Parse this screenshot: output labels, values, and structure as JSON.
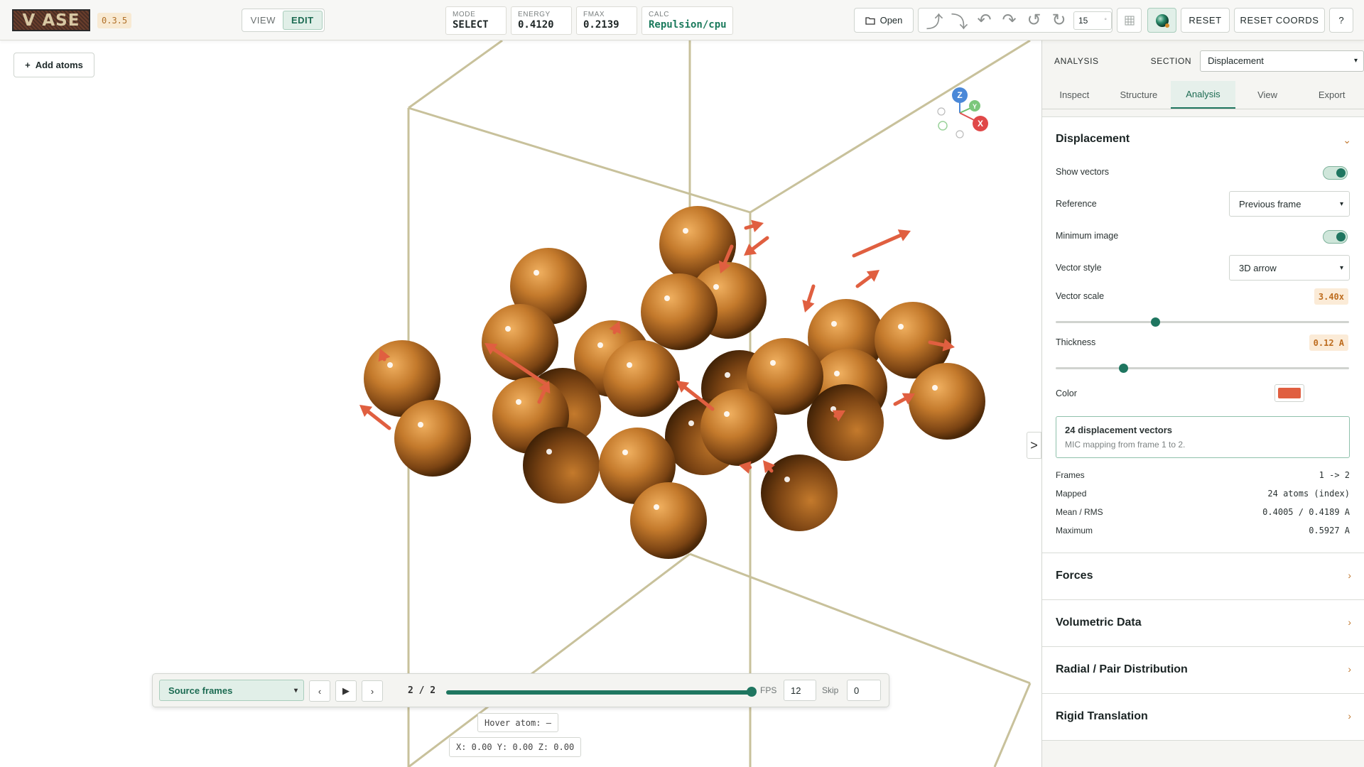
{
  "app": {
    "logo": "V ASE",
    "version": "0.3.5"
  },
  "toolbar": {
    "mode_view": "VIEW",
    "mode_edit": "EDIT",
    "stats": [
      {
        "key": "MODE",
        "value": "SELECT"
      },
      {
        "key": "ENERGY",
        "value": "0.4120"
      },
      {
        "key": "FMAX",
        "value": "0.2139"
      },
      {
        "key": "CALC",
        "value": "Repulsion/cpu"
      }
    ],
    "open_label": "Open",
    "angle": "15",
    "angle_unit": "°",
    "reset_label": "RESET",
    "reset_coords_label": "RESET COORDS",
    "help_label": "?",
    "icons": [
      "folder-icon",
      "rotate-up-icon",
      "rotate-down-icon",
      "rotate-left-icon",
      "rotate-right-icon",
      "rotate-ccw-icon",
      "rotate-cw-icon",
      "grid-icon",
      "sphere-render-icon"
    ]
  },
  "viewport": {
    "add_atoms_label": "Add atoms",
    "axes": {
      "x": "X",
      "y": "Y",
      "z": "Z"
    },
    "atom_color": "#c47a2c",
    "arrow_color": "#e05f40",
    "cell_color": "#c8c19b",
    "hover_atom": "Hover atom: –",
    "coords": "X: 0.00  Y: 0.00  Z: 0.00",
    "collapse_label": ">"
  },
  "playback": {
    "source_select": "Source frames",
    "frame_counter": "2 / 2",
    "progress": 1.0,
    "fps_label": "FPS",
    "fps_value": "12",
    "skip_label": "Skip",
    "skip_value": "0"
  },
  "panel": {
    "header_label": "ANALYSIS",
    "section_label": "SECTION",
    "section_value": "Displacement",
    "tabs": [
      "Inspect",
      "Structure",
      "Analysis",
      "View",
      "Export"
    ],
    "active_tab": "Analysis",
    "displacement": {
      "title": "Displacement",
      "show_vectors_label": "Show vectors",
      "show_vectors": true,
      "reference_label": "Reference",
      "reference_value": "Previous frame",
      "minimum_image_label": "Minimum image",
      "minimum_image": true,
      "vector_style_label": "Vector style",
      "vector_style_value": "3D arrow",
      "vector_scale_label": "Vector scale",
      "vector_scale_value": "3.40x",
      "vector_scale_fraction": 0.34,
      "thickness_label": "Thickness",
      "thickness_value": "0.12 A",
      "thickness_fraction": 0.23,
      "color_label": "Color",
      "color_value": "#e05f40",
      "info_title": "24 displacement vectors",
      "info_subtitle": "MIC mapping from frame 1 to 2.",
      "stats": [
        {
          "key": "Frames",
          "value": "1 -> 2"
        },
        {
          "key": "Mapped",
          "value": "24 atoms (index)"
        },
        {
          "key": "Mean / RMS",
          "value": "0.4005 / 0.4189 A"
        },
        {
          "key": "Maximum",
          "value": "0.5927 A"
        }
      ]
    },
    "sections": [
      "Forces",
      "Volumetric Data",
      "Radial / Pair Distribution",
      "Rigid Translation"
    ]
  }
}
